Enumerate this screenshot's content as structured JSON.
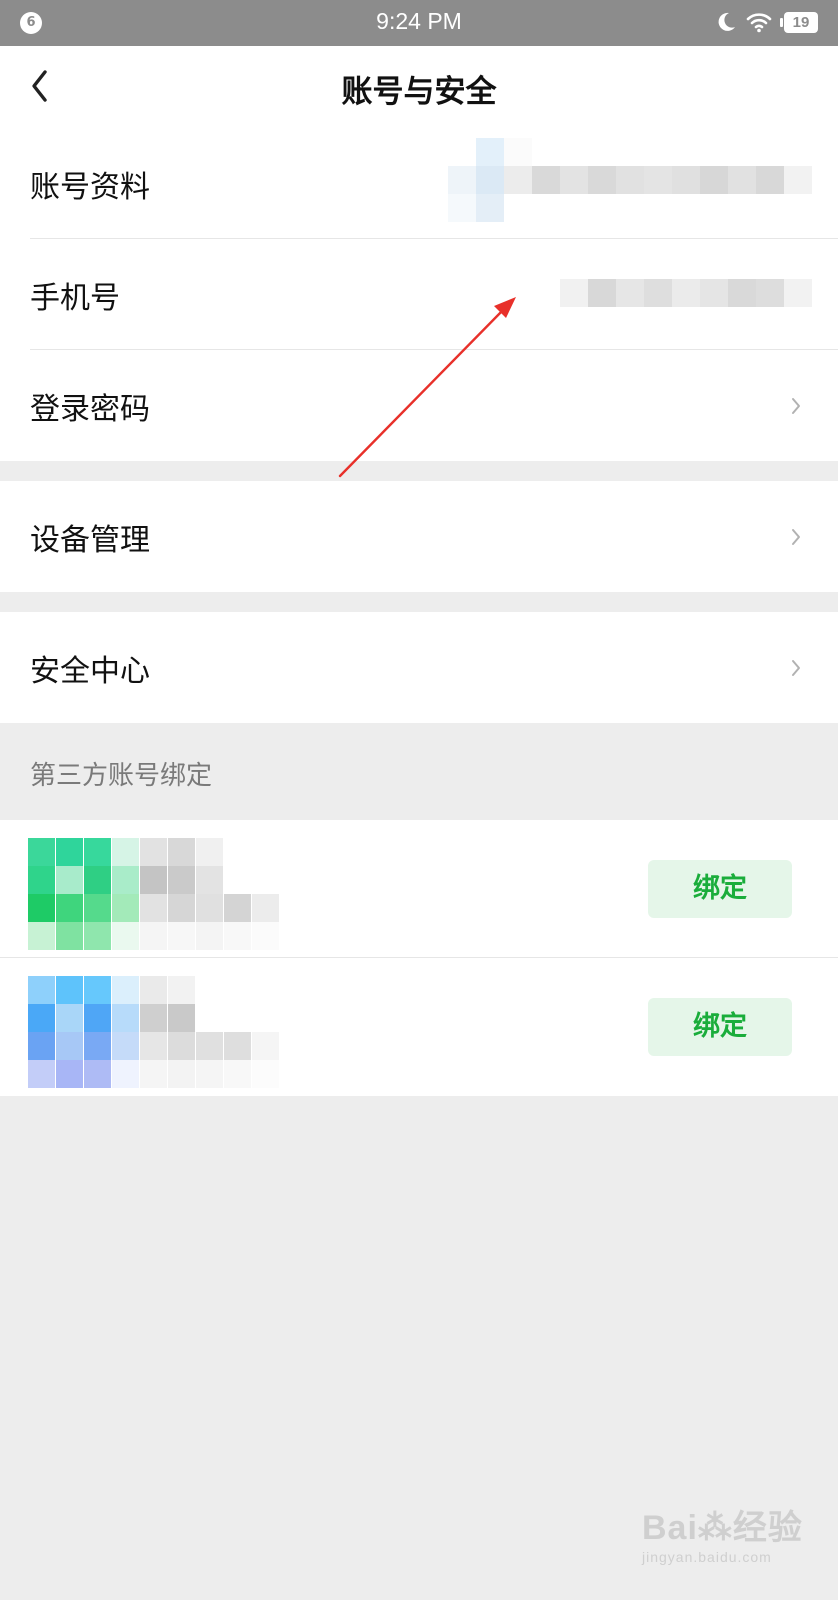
{
  "status_bar": {
    "notification_count": "6",
    "time": "9:24 PM",
    "battery": "19",
    "icons": [
      "moon-icon",
      "wifi-icon",
      "battery-icon"
    ]
  },
  "nav": {
    "title": "账号与安全",
    "back_icon": "chevron-left-icon"
  },
  "cells": {
    "account_info": {
      "label": "账号资料"
    },
    "phone": {
      "label": "手机号"
    },
    "login_password": {
      "label": "登录密码"
    },
    "device_management": {
      "label": "设备管理"
    },
    "security_center": {
      "label": "安全中心"
    }
  },
  "third_party": {
    "header": "第三方账号绑定",
    "rows": [
      {
        "button_label": "绑定",
        "accent": "#2bcf7a"
      },
      {
        "button_label": "绑定",
        "accent": "#5aaaf7"
      }
    ]
  },
  "watermark": {
    "main": "Bai⁂经验",
    "sub": "jingyan.baidu.com"
  },
  "colors": {
    "accent_green": "#1aad3b",
    "button_bg": "#e5f6e9",
    "page_bg": "#ededed",
    "annotation": "#e8302a"
  }
}
